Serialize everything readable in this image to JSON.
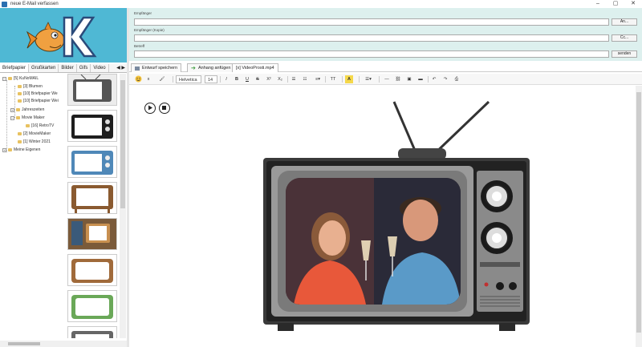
{
  "window": {
    "title": "neue E-Mail verfassen",
    "controls": [
      "–",
      "▢",
      "✕"
    ]
  },
  "left": {
    "tabs": [
      "Briefpapier",
      "Grußkarten",
      "Bilder",
      "Gifs",
      "Video"
    ],
    "tab_arrows": "◀ ▶",
    "tree": [
      {
        "label": "[5] KuNoMAIL",
        "expander": "−"
      },
      {
        "label": "[3] Blumen"
      },
      {
        "label": "[10] Briefpapier We"
      },
      {
        "label": "[10] Briefpapier Wei"
      },
      {
        "label": "Jahreszeiten",
        "expander": "+"
      },
      {
        "label": "Movie Maker",
        "expander": "−"
      },
      {
        "label": "[16] RetroTV"
      },
      {
        "label": "[2] MovieMaker"
      },
      {
        "label": "[1] Winter 2021"
      },
      {
        "label": "Meine Eigenen",
        "expander": "+"
      }
    ]
  },
  "header": {
    "to_label": "Empfänger",
    "to_value": "",
    "to_button": "An...",
    "cc_label": "Empfänger (Kopie)",
    "cc_value": "",
    "cc_button": "Cc...",
    "subject_label": "Betreff",
    "subject_value": "",
    "send_button": "senden"
  },
  "tabs": {
    "save_draft": "Entwurf speichern",
    "attach": "Anhang anfügen",
    "attachment_file": "[x] VideoProsti.mp4"
  },
  "toolbar": {
    "font": "Helvetica",
    "size": "14",
    "bold": "B",
    "italic": "I",
    "underline": "U",
    "strike": "S",
    "superscript": "X²",
    "subscript": "X₂",
    "font_size_btn": "TT",
    "font_color": "A",
    "clear": "x"
  },
  "colors": {
    "logo_bg": "#4fb8d4",
    "header_bg": "#ddf0ee",
    "tv_wood": "#2f2f2f",
    "accent_green": "#3a9a3a"
  }
}
